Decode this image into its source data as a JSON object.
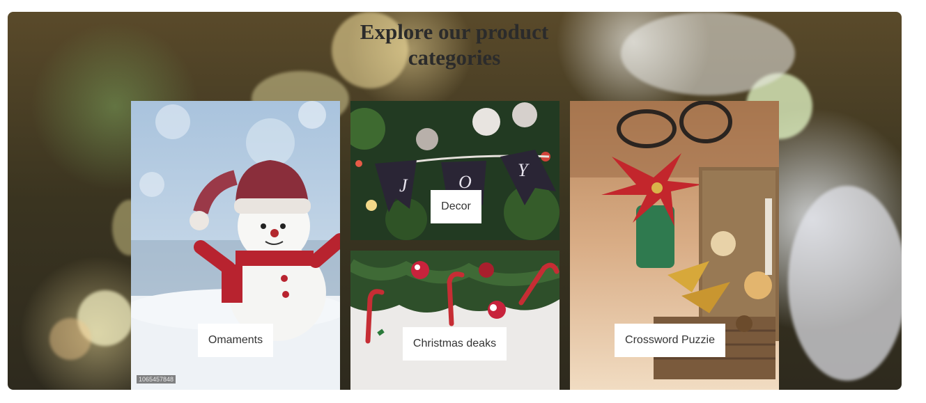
{
  "section": {
    "title": "Explore our product categories"
  },
  "categories": [
    {
      "label": "Omaments",
      "image": "snowman-photo",
      "stock_id": "1065457848"
    },
    {
      "label": "Decor",
      "image": "joy-banner-tree-photo"
    },
    {
      "label": "Christmas deaks",
      "image": "candy-cane-garland-photo"
    },
    {
      "label": "Crossword Puzzie",
      "image": "poinsettia-basket-photo"
    }
  ],
  "colors": {
    "title_text": "#2b2b2b",
    "label_bg": "#ffffff",
    "label_text": "#333333"
  }
}
